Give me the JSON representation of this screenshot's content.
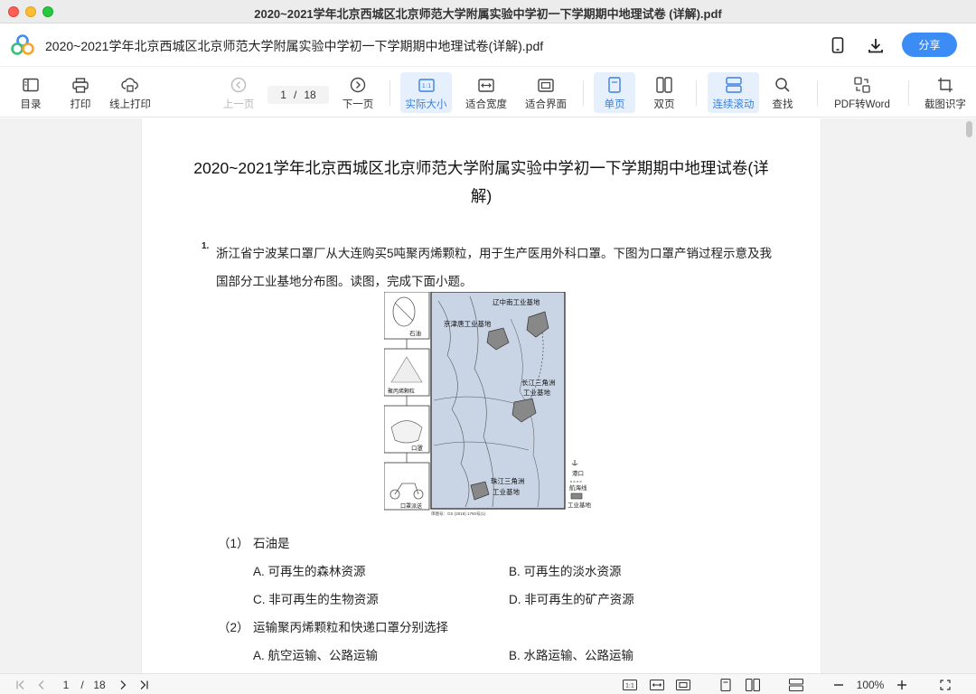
{
  "window": {
    "title": "2020~2021学年北京西城区北京师范大学附属实验中学初一下学期期中地理试卷 (详解).pdf"
  },
  "header": {
    "doc_title": "2020~2021学年北京西城区北京师范大学附属实验中学初一下学期期中地理试卷(详解).pdf",
    "share_label": "分享"
  },
  "toolbar": {
    "toc": "目录",
    "print": "打印",
    "online_print": "线上打印",
    "prev": "上一页",
    "current_page": "1",
    "slash": "/",
    "total_pages": "18",
    "next": "下一页",
    "actual_size": "实际大小",
    "fit_width": "适合宽度",
    "fit_window": "适合界面",
    "single_page": "单页",
    "double_page": "双页",
    "continuous": "连续滚动",
    "search": "查找",
    "pdf_to_word": "PDF转Word",
    "ocr": "截图识字"
  },
  "document": {
    "heading_line1": "2020~2021学年北京西城区北京师范大学附属实验中学初一下学期期中地理试卷(详",
    "heading_line2": "解)",
    "q1_number": "1.",
    "q1_text": "浙江省宁波某口罩厂从大连购买5吨聚丙烯颗粒，用于生产医用外科口罩。下图为口罩产销过程示意及我国部分工业基地分布图。读图，完成下面小题。",
    "figure": {
      "step1": "石油",
      "step2": "聚丙烯颗粒",
      "step3": "口罩",
      "step4": "口罩派送",
      "base_liaozhongnan": "辽中南工业基地",
      "base_jingjintang": "京津唐工业基地",
      "base_changjiang_1": "长江三角洲",
      "base_changjiang_2": "工业基地",
      "base_zhujiang_1": "珠江三角洲",
      "base_zhujiang_2": "工业基地",
      "legend_port": "港口",
      "legend_route": "航海线",
      "legend_base": "工业基地",
      "map_no": "审图号：GS (2019) 1760号(1)"
    },
    "sub1_label": "（1）",
    "sub1_text": "石油是",
    "sub1_options": [
      "A. 可再生的森林资源",
      "B. 可再生的淡水资源",
      "C. 非可再生的生物资源",
      "D. 非可再生的矿产资源"
    ],
    "sub2_label": "（2）",
    "sub2_text": "运输聚丙烯颗粒和快递口罩分别选择",
    "sub2_options": [
      "A. 航空运输、公路运输",
      "B. 水路运输、公路运输"
    ]
  },
  "statusbar": {
    "current_page": "1",
    "slash": "/",
    "total_pages": "18",
    "zoom": "100%"
  }
}
